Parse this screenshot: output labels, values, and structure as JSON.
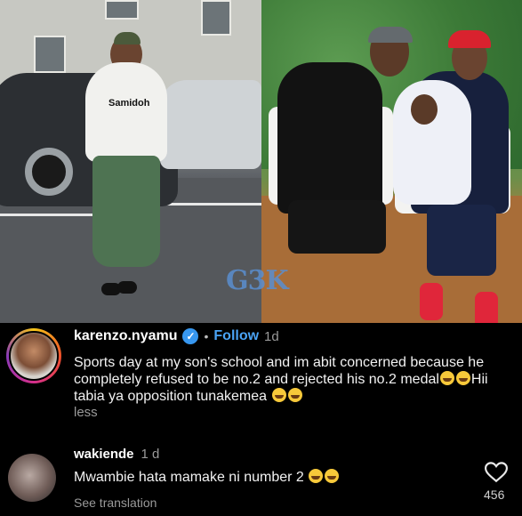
{
  "photo": {
    "left_hoodie_text": "Samidoh",
    "watermark": "G3K"
  },
  "post": {
    "username": "karenzo.nyamu",
    "verified_glyph": "✓",
    "separator": "•",
    "follow_label": "Follow",
    "time": "1d",
    "caption_part1": "Sports day at my son's school and im abit concerned because he completely refused to be no.2 and rejected his no.2 medal",
    "caption_part2": "Hii tabia ya opposition tunakemea",
    "less_label": "less"
  },
  "comment": {
    "username": "wakiende",
    "time": "1 d",
    "text": "Mwambie hata mamake ni number 2",
    "see_translation": "See translation",
    "likes": "456"
  },
  "icons": {
    "verified": "verified-badge-icon",
    "like": "heart-icon",
    "emoji": "laughing-emoji-icon"
  },
  "colors": {
    "follow": "#4aa3f5",
    "verified": "#3797f0",
    "background": "#000000"
  }
}
